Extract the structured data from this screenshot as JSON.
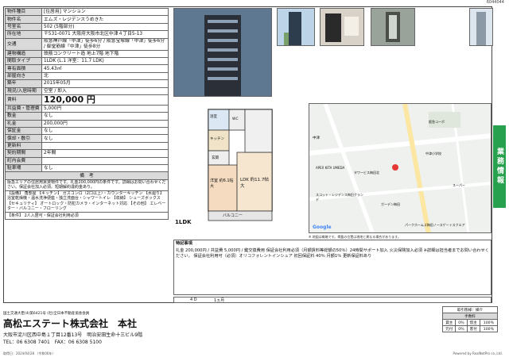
{
  "doc_id": "6044044",
  "spec": {
    "rows": [
      {
        "key": "物件種目",
        "value": "[住居用] マンション"
      },
      {
        "key": "物件名",
        "value": "エムズ・レジデンスうめきた"
      },
      {
        "key": "号室名",
        "value": "502 (5階部分)"
      },
      {
        "key": "所在地",
        "value": "〒531-0071 大阪府大阪市北区中津４丁目5-13"
      },
      {
        "key": "交通",
        "value": "阪急神戸線「中津」徒歩6分 / 阪急宝塚線「中津」徒歩6分 / 御堂筋線「中津」徒歩8分"
      },
      {
        "key": "建物構造",
        "value": "鉄筋コンクリート造 地上7階 地下階"
      },
      {
        "key": "間取タイプ",
        "value": "1LDK (L.1 洋室：11.7 LDK)"
      },
      {
        "key": "専有面積",
        "value": "45.43㎡"
      },
      {
        "key": "部屋向き",
        "value": "北"
      },
      {
        "key": "築年",
        "value": "2015年05月"
      },
      {
        "key": "現況/入居時期",
        "value": "空室 / 即入"
      }
    ],
    "rent_label": "賃料",
    "rent_value": "120,000 円",
    "fees": [
      {
        "key": "共益費・管理費",
        "value": "5,000円"
      },
      {
        "key": "敷金",
        "value": "なし"
      },
      {
        "key": "礼金",
        "value": "200,000円"
      },
      {
        "key": "保証金",
        "value": "なし"
      },
      {
        "key": "償却・敷引",
        "value": "なし"
      },
      {
        "key": "更新料",
        "value": ""
      },
      {
        "key": "契約期間",
        "value": "2年間"
      },
      {
        "key": "町内会費",
        "value": ""
      },
      {
        "key": "駐車場",
        "value": "なし"
      }
    ],
    "notes_head": "備　考",
    "notes_text": "阪急エリアの住居用賃貸物件です。礼金200,000円の条件です。詳細はお問い合わせください。保証会社加入必須。短期解約違約金あり。",
    "facilities_text": "【設備】 角部屋 【キッチン】 ガスコンロ（2口以上）・カウンターキッチン 【水廻り】 浴室乾燥機・温水洗浄便座・独立洗面台・シャワートイレ 【収納】 シューズボックス 【セキュリティ】 オートロック・防犯カメラ・インターネット対応 【その他】 エレベーター・バルコニー・フローリング",
    "conditions_text": "【条件】 2人入居可・保証会社利用必須"
  },
  "photos": {
    "building_caption": "",
    "thumb_captions": [
      "",
      "",
      "",
      ""
    ]
  },
  "floorplan": {
    "title": "1LDK",
    "rooms": {
      "washitsu": "洋室 約6.1帖大",
      "ldk": "LDK 約11.7帖大",
      "balcony": "バルコニー",
      "entrance": "玄関",
      "bath": "浴室",
      "wc": "WC",
      "kitchen": "キッチン"
    }
  },
  "map": {
    "labels": [
      "中津",
      "APEX KITA UMEDA",
      "タワービス梅田北",
      "スコット・レジデンス梅田グランデ",
      "パークホームズ梅田ノースゲートスクエア",
      "阪急コーポ",
      "中津小学校",
      "スーパー",
      "ガーデン梅田"
    ],
    "attribution": "※ 地図は概略です。掲載の位置は現地と異なる場合があります。",
    "copyright": "Google"
  },
  "remarks": {
    "head": "特記事項",
    "text": "礼金 200,000円 / 共益費 5,000円 / 鍵交換費用 保証会社利用必須（月額賃料等総額の50％）24時間サポート加入 火災保険加入必須 ※詳細は担当者までお問い合わせください。 保証会社利用可（必須）オリコフォレントインシュア 初回保証料 40％ 月額1％ 更新保証料あり"
  },
  "bottom_bar": {
    "left": "4 D",
    "right": "1ヵ月"
  },
  "company": {
    "license": "国土交通大臣(4)第6421号 (社)全日本不動産協会会員",
    "name": "高松エステート株式会社　本社",
    "address": "大阪市淀川区西中島１丁目12番13号　明治安田生命十三ビル9階",
    "tel": "TEL：06 6308 7401　FAX：06 6308 5100"
  },
  "fee_table": {
    "head": "取引態様：媒介",
    "sub": "手数料",
    "rows": [
      [
        "貸主",
        "0％",
        "借主",
        "100％"
      ],
      [
        "元付",
        "0％",
        "客付",
        "100％"
      ]
    ]
  },
  "footer": {
    "date": "取得日：2024/04/28 （令和06年）",
    "powered": "Powered by RealNetPro co.,Ltd."
  },
  "tab_label": "業務情報"
}
